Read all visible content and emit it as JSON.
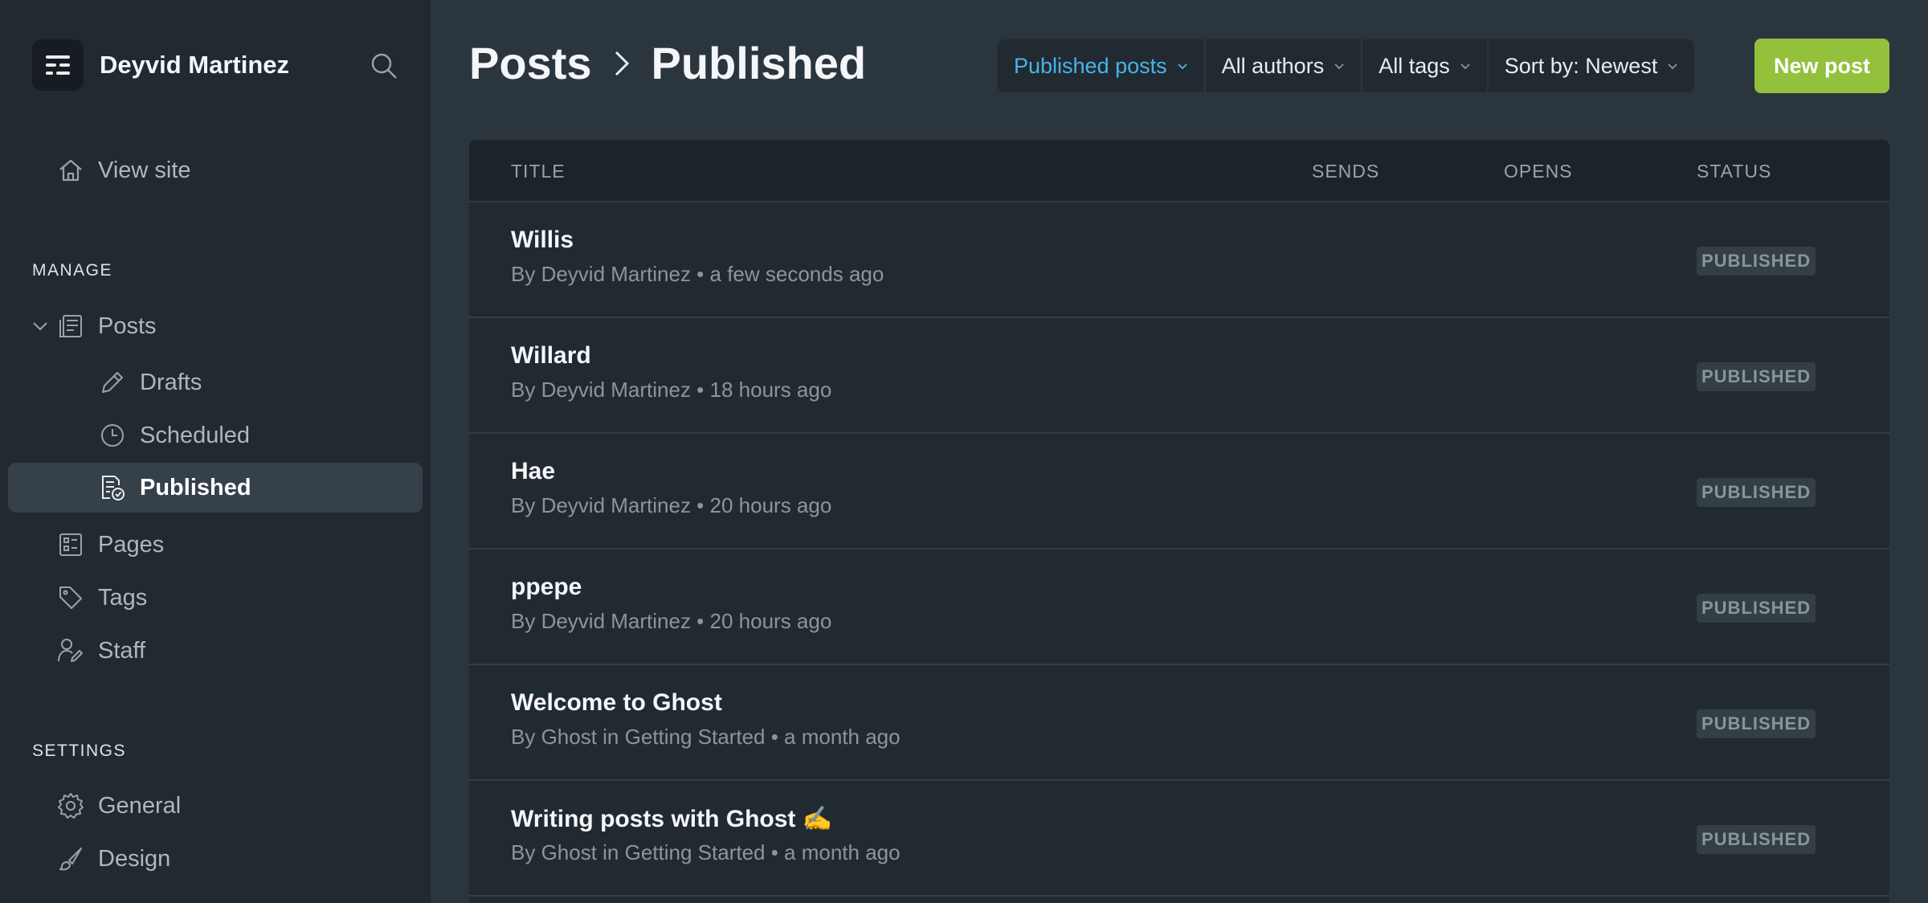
{
  "brand": {
    "name": "Deyvid Martinez"
  },
  "sidebar": {
    "view_site": "View site",
    "manage_title": "MANAGE",
    "posts": "Posts",
    "drafts": "Drafts",
    "scheduled": "Scheduled",
    "published": "Published",
    "pages": "Pages",
    "tags": "Tags",
    "staff": "Staff",
    "settings_title": "SETTINGS",
    "general": "General",
    "design": "Design"
  },
  "header": {
    "crumb_root": "Posts",
    "crumb_current": "Published",
    "filters": {
      "type": "Published posts",
      "authors": "All authors",
      "tags": "All tags",
      "sort": "Sort by: Newest"
    },
    "new_post": "New post"
  },
  "table": {
    "columns": {
      "title": "TITLE",
      "sends": "SENDS",
      "opens": "OPENS",
      "status": "STATUS"
    },
    "rows": [
      {
        "title": "Willis",
        "meta": "By Deyvid Martinez • a few seconds ago",
        "status": "PUBLISHED"
      },
      {
        "title": "Willard",
        "meta": "By Deyvid Martinez • 18 hours ago",
        "status": "PUBLISHED"
      },
      {
        "title": "Hae",
        "meta": "By Deyvid Martinez • 20 hours ago",
        "status": "PUBLISHED"
      },
      {
        "title": "ppepe",
        "meta": "By Deyvid Martinez • 20 hours ago",
        "status": "PUBLISHED"
      },
      {
        "title": "Welcome to Ghost",
        "meta": "By Ghost in Getting Started • a month ago",
        "status": "PUBLISHED"
      },
      {
        "title": "Writing posts with Ghost ✍️",
        "meta": "By Ghost in Getting Started • a month ago",
        "status": "PUBLISHED"
      }
    ]
  },
  "colors": {
    "accent": "#4ab3e6",
    "primary_button": "#94c13b",
    "sidebar_bg": "#222a31",
    "main_bg": "#2b353e"
  }
}
